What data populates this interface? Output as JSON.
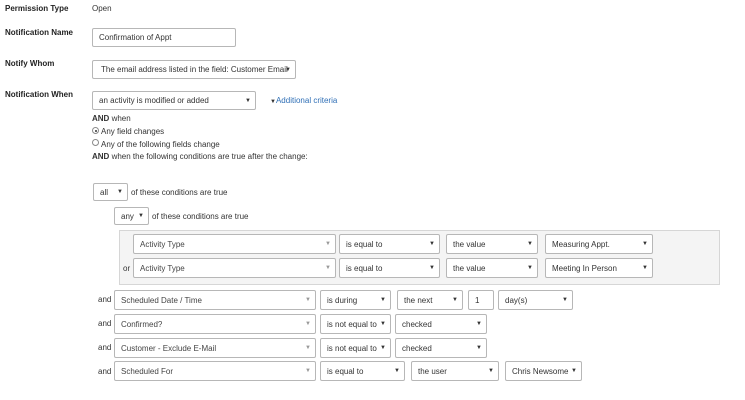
{
  "fields": {
    "permission_type": {
      "label": "Permission Type",
      "value": "Open"
    },
    "notification_name": {
      "label": "Notification Name",
      "value": "Confirmation of Appt"
    },
    "notify_whom": {
      "label": "Notify Whom",
      "value": "The email address listed in the field: Customer Email"
    },
    "notification_when": {
      "label": "Notification When",
      "value": "an activity is modified or added",
      "link": "Additional criteria"
    }
  },
  "and_when": {
    "and_bold": "AND",
    "when_text": "when",
    "radio_any": "Any field changes",
    "radio_following": "Any of the following fields change",
    "selected": "Any field changes",
    "conditions_text": "when the following conditions are true after the change:"
  },
  "outer_group": {
    "quantifier": "all",
    "suffix": "of these conditions are true"
  },
  "inner_group": {
    "quantifier": "any",
    "suffix": "of these conditions are true",
    "rows": [
      {
        "connector": "",
        "field": "Activity Type",
        "operator": "is equal to",
        "mode": "the value",
        "value": "Measuring Appt."
      },
      {
        "connector": "or",
        "field": "Activity Type",
        "operator": "is equal to",
        "mode": "the value",
        "value": "Meeting In Person"
      }
    ]
  },
  "conditions": [
    {
      "connector": "and",
      "field": "Scheduled Date / Time",
      "operator": "is during",
      "mode": "the next",
      "number": "1",
      "unit": "day(s)"
    },
    {
      "connector": "and",
      "field": "Confirmed?",
      "operator": "is not equal to",
      "value": "checked"
    },
    {
      "connector": "and",
      "field": "Customer - Exclude E-Mail",
      "operator": "is not equal to",
      "value": "checked"
    },
    {
      "connector": "and",
      "field": "Scheduled For",
      "operator": "is equal to",
      "mode": "the user",
      "value": "Chris Newsome"
    }
  ],
  "colors": {
    "link": "#2f6fb6",
    "panel": "#f4f4f4",
    "border": "#b7b7b7"
  }
}
